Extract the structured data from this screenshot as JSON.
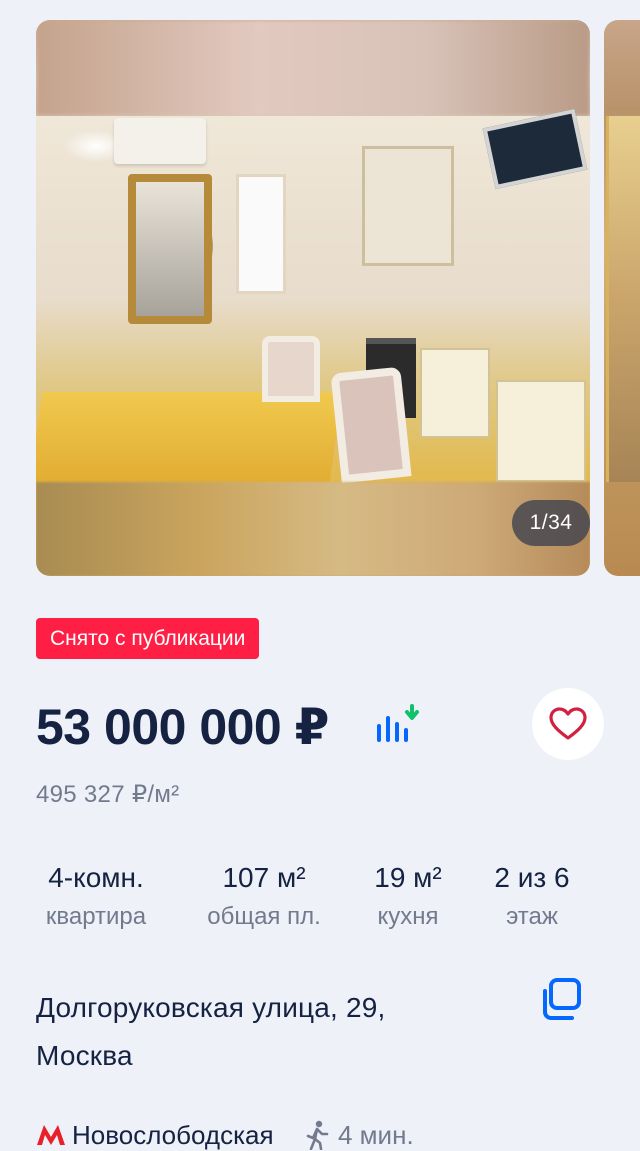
{
  "gallery": {
    "counter": "1/34"
  },
  "status_badge": "Снято с публикации",
  "price": {
    "value": "53 000 000 ₽",
    "per_meter": "495 327 ₽/м²"
  },
  "specs": [
    {
      "value": "4-комн.",
      "label": "квартира"
    },
    {
      "value": "107 м²",
      "label": "общая пл."
    },
    {
      "value": "19 м²",
      "label": "кухня"
    },
    {
      "value": "2 из 6",
      "label": "этаж"
    }
  ],
  "address": {
    "line1": "Долгоруковская улица, 29,",
    "line2": "Москва"
  },
  "metro": {
    "station": "Новослободская",
    "walk_time": "4 мин."
  },
  "colors": {
    "badge": "#ff1f45",
    "heart": "#d3203f",
    "accent_blue": "#0468ff",
    "text_primary": "#152242",
    "text_secondary": "#737a8e"
  },
  "icons": {
    "favorite": "heart-icon",
    "price_chart": "price-chart-icon",
    "copy": "copy-icon",
    "metro": "metro-icon",
    "walk": "walk-icon"
  }
}
